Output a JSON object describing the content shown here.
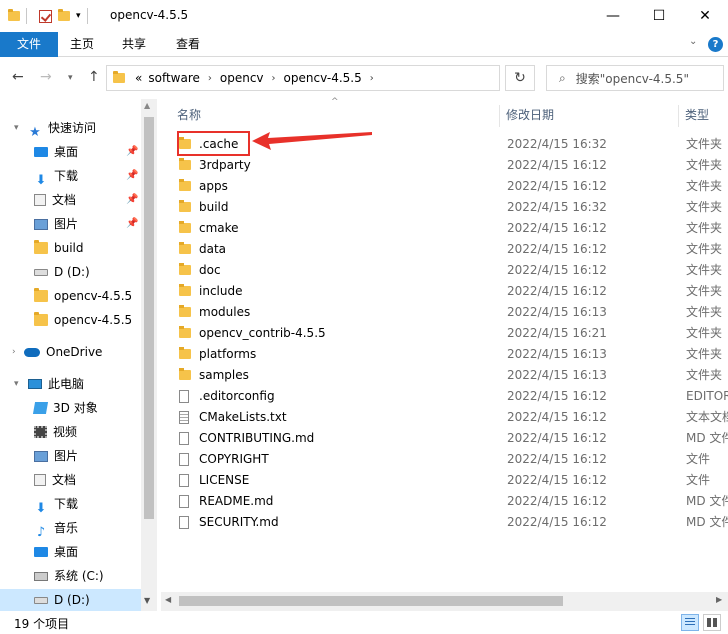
{
  "window": {
    "title": "opencv-4.5.5",
    "controls": {
      "minimize": "—",
      "maximize": "☐",
      "close": "✕"
    }
  },
  "ribbon": {
    "tabs": [
      {
        "label": "文件"
      },
      {
        "label": "主页"
      },
      {
        "label": "共享"
      },
      {
        "label": "查看"
      }
    ],
    "expand_icon": "chevron-down-icon",
    "help_icon": "help-icon"
  },
  "address": {
    "overflow": "«",
    "crumbs": [
      "software",
      "opencv",
      "opencv-4.5.5"
    ],
    "search_placeholder": "搜索\"opencv-4.5.5\""
  },
  "nav": {
    "quick_access": "快速访问",
    "items": [
      {
        "label": "桌面",
        "icon": "desktop-icon",
        "pinned": true
      },
      {
        "label": "下载",
        "icon": "download-icon",
        "pinned": true
      },
      {
        "label": "文档",
        "icon": "document-icon",
        "pinned": true
      },
      {
        "label": "图片",
        "icon": "picture-icon",
        "pinned": true
      },
      {
        "label": "build",
        "icon": "folder-icon"
      },
      {
        "label": "D (D:)",
        "icon": "drive-icon"
      },
      {
        "label": "opencv-4.5.5",
        "icon": "folder-icon"
      },
      {
        "label": "opencv-4.5.5",
        "icon": "folder-icon"
      }
    ],
    "onedrive": "OneDrive",
    "this_pc": "此电脑",
    "pc_items": [
      {
        "label": "3D 对象",
        "icon": "3d-objects-icon"
      },
      {
        "label": "视频",
        "icon": "video-icon"
      },
      {
        "label": "图片",
        "icon": "picture-icon"
      },
      {
        "label": "文档",
        "icon": "document-icon"
      },
      {
        "label": "下载",
        "icon": "download-icon"
      },
      {
        "label": "音乐",
        "icon": "music-icon"
      },
      {
        "label": "桌面",
        "icon": "desktop-icon"
      },
      {
        "label": "系统 (C:)",
        "icon": "system-drive-icon"
      },
      {
        "label": "D (D:)",
        "icon": "drive-icon",
        "selected": true
      }
    ]
  },
  "columns": {
    "name": "名称",
    "date": "修改日期",
    "type": "类型"
  },
  "files": [
    {
      "name": ".cache",
      "date": "2022/4/15 16:32",
      "type": "文件夹",
      "kind": "folder"
    },
    {
      "name": "3rdparty",
      "date": "2022/4/15 16:12",
      "type": "文件夹",
      "kind": "folder"
    },
    {
      "name": "apps",
      "date": "2022/4/15 16:12",
      "type": "文件夹",
      "kind": "folder"
    },
    {
      "name": "build",
      "date": "2022/4/15 16:32",
      "type": "文件夹",
      "kind": "folder"
    },
    {
      "name": "cmake",
      "date": "2022/4/15 16:12",
      "type": "文件夹",
      "kind": "folder"
    },
    {
      "name": "data",
      "date": "2022/4/15 16:12",
      "type": "文件夹",
      "kind": "folder"
    },
    {
      "name": "doc",
      "date": "2022/4/15 16:12",
      "type": "文件夹",
      "kind": "folder"
    },
    {
      "name": "include",
      "date": "2022/4/15 16:12",
      "type": "文件夹",
      "kind": "folder"
    },
    {
      "name": "modules",
      "date": "2022/4/15 16:13",
      "type": "文件夹",
      "kind": "folder"
    },
    {
      "name": "opencv_contrib-4.5.5",
      "date": "2022/4/15 16:21",
      "type": "文件夹",
      "kind": "folder"
    },
    {
      "name": "platforms",
      "date": "2022/4/15 16:13",
      "type": "文件夹",
      "kind": "folder"
    },
    {
      "name": "samples",
      "date": "2022/4/15 16:13",
      "type": "文件夹",
      "kind": "folder"
    },
    {
      "name": ".editorconfig",
      "date": "2022/4/15 16:12",
      "type": "EDITOR",
      "kind": "file"
    },
    {
      "name": "CMakeLists.txt",
      "date": "2022/4/15 16:12",
      "type": "文本文档",
      "kind": "text"
    },
    {
      "name": "CONTRIBUTING.md",
      "date": "2022/4/15 16:12",
      "type": "MD 文件",
      "kind": "file"
    },
    {
      "name": "COPYRIGHT",
      "date": "2022/4/15 16:12",
      "type": "文件",
      "kind": "file"
    },
    {
      "name": "LICENSE",
      "date": "2022/4/15 16:12",
      "type": "文件",
      "kind": "file"
    },
    {
      "name": "README.md",
      "date": "2022/4/15 16:12",
      "type": "MD 文件",
      "kind": "file"
    },
    {
      "name": "SECURITY.md",
      "date": "2022/4/15 16:12",
      "type": "MD 文件",
      "kind": "file"
    }
  ],
  "status": {
    "count": "19 个项目"
  },
  "annotation": {
    "color": "#e8312a"
  }
}
